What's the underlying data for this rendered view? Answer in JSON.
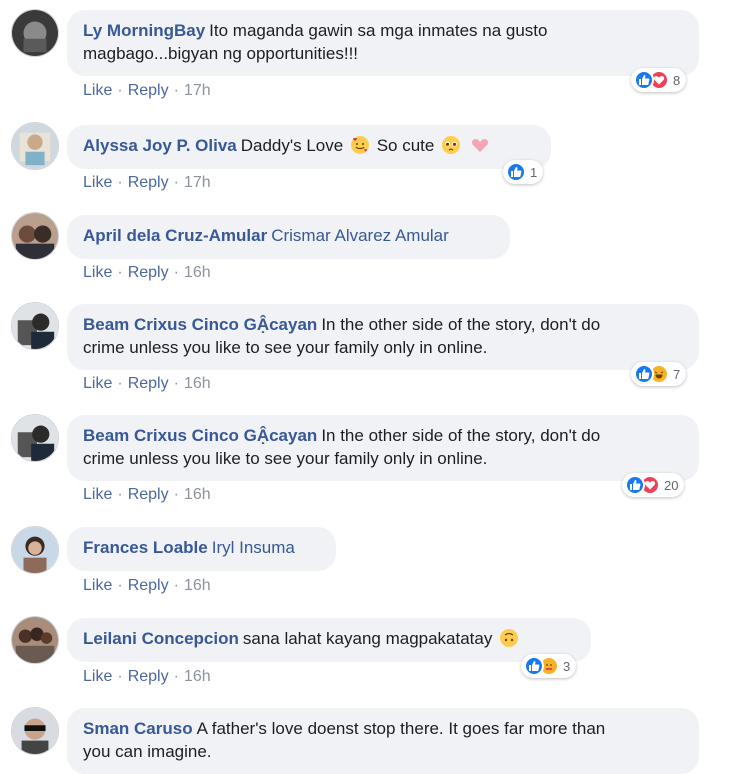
{
  "action_labels": {
    "like": "Like",
    "reply": "Reply",
    "sep": "·"
  },
  "comments": [
    {
      "author": "Ly MorningBay",
      "text": "Ito maganda gawin sa mga inmates na gusto",
      "text2": "magbago...bigyan ng opportunities!!!",
      "time": "17h",
      "reaction_count": "8",
      "reactions": [
        "like-icon",
        "love-icon"
      ]
    },
    {
      "author": "Alyssa Joy P. Oliva",
      "text": "Daddy's Love",
      "text_b": "So cute",
      "emojis": [
        "smiling-face-with-hearts-emoji",
        "pleading-face-emoji",
        "heart-emoji"
      ],
      "time": "17h",
      "reaction_count": "1",
      "reactions": [
        "like-icon"
      ]
    },
    {
      "author": "April dela Cruz-Amular",
      "mention": "Crismar Alvarez Amular",
      "time": "16h"
    },
    {
      "author": "Beam Crixus Cinco GẬcayan",
      "text": "In the other side of the story, don't do",
      "text2": "crime unless you like to see your family only in online.",
      "time": "16h",
      "reaction_count": "7",
      "reactions": [
        "like-icon",
        "haha-icon"
      ]
    },
    {
      "author": "Beam Crixus Cinco GẬcayan",
      "text": "In the other side of the story, don't do",
      "text2": "crime unless you like to see your family only in online.",
      "time": "16h",
      "reaction_count": "20",
      "reactions": [
        "like-icon",
        "love-icon"
      ]
    },
    {
      "author": "Frances Loable",
      "mention": "Iryl Insuma",
      "time": "16h"
    },
    {
      "author": "Leilani Concepcion",
      "text": "sana lahat kayang magpakatatay",
      "emojis": [
        "upside-down-face-emoji"
      ],
      "time": "16h",
      "reaction_count": "3",
      "reactions": [
        "like-icon",
        "care-icon"
      ]
    },
    {
      "author": "Sman Caruso",
      "text": "A father's love doenst stop there. It goes far more than",
      "text2": "you can imagine."
    }
  ],
  "colors": {
    "link": "#385898",
    "bubble": "#f0f2f5",
    "like": "#1877f2",
    "love": "#f33e58",
    "haha": "#f7b125",
    "meta": "#8d949e"
  }
}
